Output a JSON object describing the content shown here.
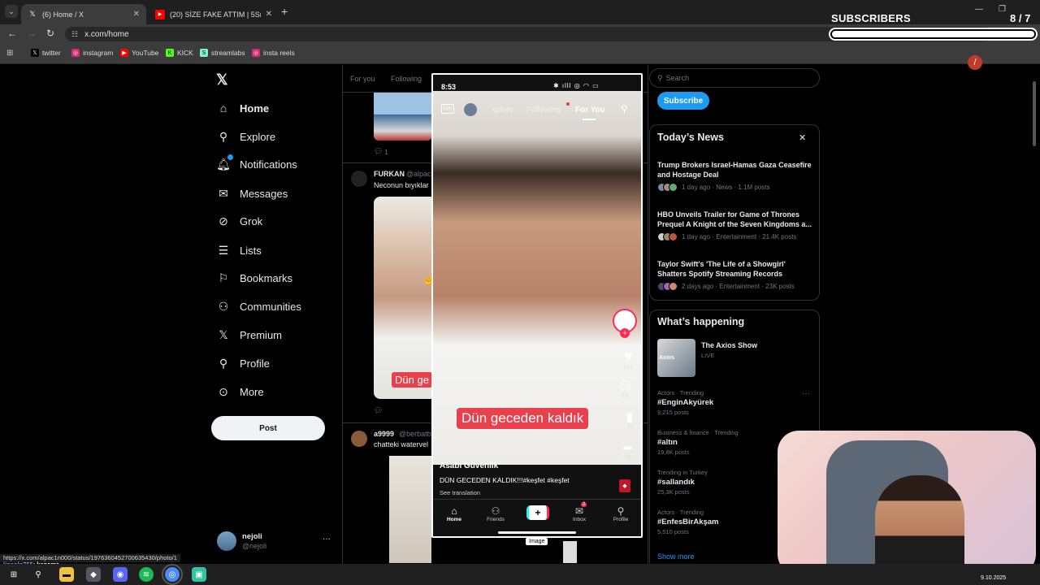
{
  "browser": {
    "tabs": [
      {
        "title": "(6) Home / X",
        "icon": "x-logo-icon"
      },
      {
        "title": "(20) SİZE FAKE ATTIM | 5Sriders",
        "icon": "youtube-icon"
      }
    ],
    "new_tab": "+",
    "url": "x.com/home",
    "bookmarks": [
      {
        "label": "twitter",
        "icon": "x-logo-icon",
        "color": "#000000"
      },
      {
        "label": "instagram",
        "icon": "instagram-icon",
        "color": "#d62976"
      },
      {
        "label": "YouTube",
        "icon": "youtube-icon",
        "color": "#ff0000"
      },
      {
        "label": "KICK",
        "icon": "kick-icon",
        "color": "#53fc18"
      },
      {
        "label": "streamlabs",
        "icon": "streamlabs-icon",
        "color": "#80f5d2"
      },
      {
        "label": "insta reels",
        "icon": "instagram-icon",
        "color": "#d62976"
      }
    ]
  },
  "overlay": {
    "subscribers_label": "SUBSCRIBERS",
    "subscribers_count": "8 / 7",
    "subscribers_progress": 1.0
  },
  "sidebar": {
    "items": [
      {
        "label": "Home",
        "icon": "home-icon",
        "active": true
      },
      {
        "label": "Explore",
        "icon": "search-icon"
      },
      {
        "label": "Notifications",
        "icon": "bell-icon"
      },
      {
        "label": "Messages",
        "icon": "envelope-icon"
      },
      {
        "label": "Grok",
        "icon": "grok-icon"
      },
      {
        "label": "Lists",
        "icon": "list-icon"
      },
      {
        "label": "Bookmarks",
        "icon": "bookmark-icon"
      },
      {
        "label": "Communities",
        "icon": "communities-icon"
      },
      {
        "label": "Premium",
        "icon": "x-logo-icon"
      },
      {
        "label": "Profile",
        "icon": "person-icon"
      },
      {
        "label": "More",
        "icon": "more-circle-icon"
      }
    ],
    "post_button": "Post",
    "account": {
      "name": "nejoli",
      "handle": "@nejoli",
      "menu": "···"
    }
  },
  "feed": {
    "tabs": [
      "For you",
      "Following"
    ],
    "post1": {
      "replies": "1"
    },
    "post2": {
      "author": "FURKAN",
      "handle": "@alpac",
      "text": "Neconun bıyıklar",
      "caption": "Dün ge"
    },
    "post3": {
      "author": "a9999",
      "handle": "@berbatb",
      "text": "chatteki watervel"
    },
    "status_url": "https://x.com/alpac1n000/status/1976360452700635430/photo/1",
    "chat_user": "lincoln755",
    "chat_msg": ": kapama"
  },
  "phone": {
    "time": "8:53",
    "tabs": [
      "xplore",
      "Following",
      "For You"
    ],
    "live_badge": "LIVE",
    "video_caption": "Dün geceden kaldık",
    "author": "Asabi Güvenlik",
    "description": "DÜN GECEDEN KALDIK!!!#keşfet #keşfet",
    "see_translation": "See translation",
    "counts": {
      "likes": "147",
      "comments": "14",
      "saves": "15",
      "shares": "19"
    },
    "nav": [
      "Home",
      "Friends",
      "",
      "Inbox",
      "Profile"
    ],
    "inbox_badge": "2",
    "tooltip": "Image"
  },
  "right": {
    "search_placeholder": "Search",
    "subscribe_button": "Subscribe",
    "news_title": "Today’s News",
    "news": [
      {
        "title": "Trump Brokers Israel-Hamas Gaza Ceasefire and Hostage Deal",
        "meta": "1 day ago · News · 1.1M posts"
      },
      {
        "title": "HBO Unveils Trailer for Game of Thrones Prequel A Knight of the Seven Kingdoms a...",
        "meta": "1 day ago · Entertainment · 21.4K posts"
      },
      {
        "title": "Taylor Swift's 'The Life of a Showgirl' Shatters Spotify Streaming Records",
        "meta": "2 days ago · Entertainment · 23K posts"
      }
    ],
    "happening_title": "What’s happening",
    "live_show": {
      "title": "The Axios Show",
      "status": "LIVE",
      "thumb_text": "Axios"
    },
    "trends": [
      {
        "context": "Actors · Trending",
        "name": "#EnginAkyürek",
        "posts": "9,215 posts"
      },
      {
        "context": "Business & finance · Trending",
        "name": "#altın",
        "posts": "19,8K posts"
      },
      {
        "context": "Trending in Turkey",
        "name": "#sallandık",
        "posts": "25,3K posts"
      },
      {
        "context": "Actors · Trending",
        "name": "#EnfesBirAkşam",
        "posts": "5,510 posts"
      }
    ],
    "show_more": "Show more"
  },
  "taskbar": {
    "date": "9.10.2025"
  }
}
